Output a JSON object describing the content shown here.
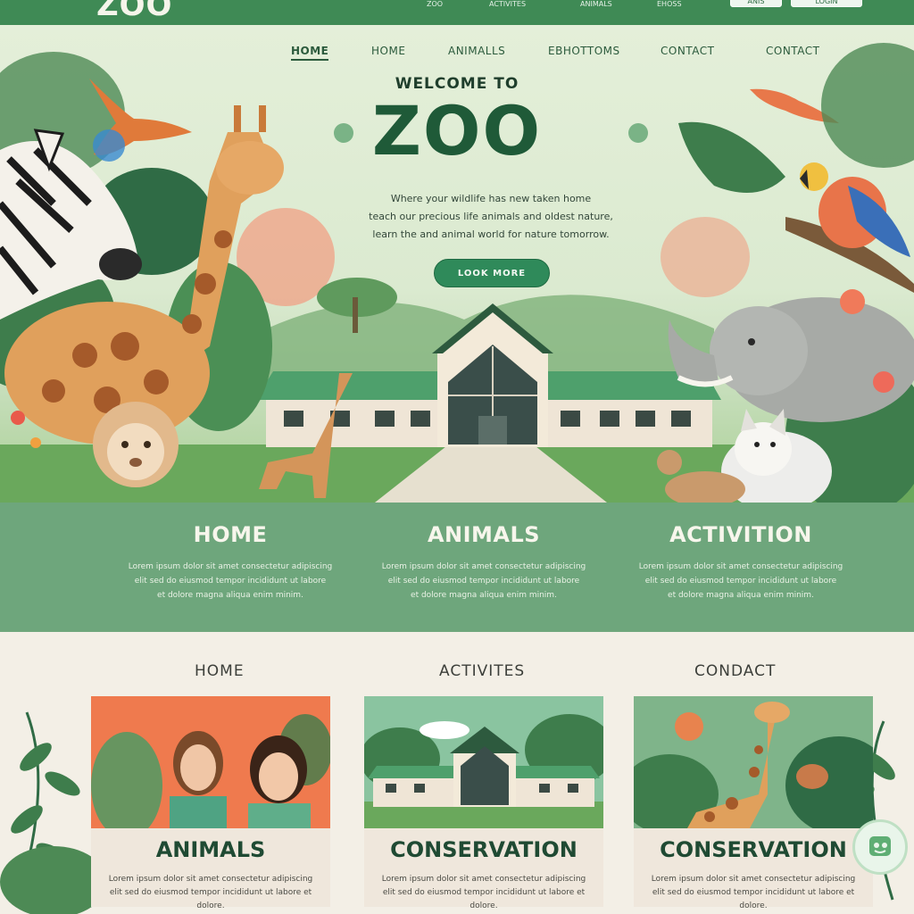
{
  "brand": {
    "logo_text": "ZOO"
  },
  "topbar": {
    "links": [
      "ZOO",
      "ACTIVITES",
      "ANIMALS",
      "EHOSS"
    ],
    "buttons": [
      "ANIS",
      "LOGIN"
    ]
  },
  "hero": {
    "nav": [
      "HOME",
      "HOME",
      "ANIMALLS",
      "EBHOTTOMS",
      "CONTACT",
      "CONTACT"
    ],
    "welcome": "WELCOME TO",
    "title": "ZOO",
    "tagline": [
      "Where your wildlife has new taken home",
      "teach our precious life animals and oldest nature,",
      "learn the and animal world for nature tomorrow."
    ],
    "cta_label": "LOOK MORE"
  },
  "strip": [
    {
      "title": "HOME",
      "lines": [
        "Lorem ipsum dolor sit amet consectetur adipiscing",
        "elit sed do eiusmod tempor incididunt ut labore",
        "et dolore magna aliqua enim minim."
      ]
    },
    {
      "title": "ANIMALS",
      "lines": [
        "Lorem ipsum dolor sit amet consectetur adipiscing",
        "elit sed do eiusmod tempor incididunt ut labore",
        "et dolore magna aliqua enim minim."
      ]
    },
    {
      "title": "ACTIVITION",
      "lines": [
        "Lorem ipsum dolor sit amet consectetur adipiscing",
        "elit sed do eiusmod tempor incididunt ut labore",
        "et dolore magna aliqua enim minim."
      ]
    }
  ],
  "cards_section": {
    "labels": [
      "HOME",
      "ACTIVITES",
      "CONDACT"
    ],
    "cards": [
      {
        "title": "ANIMALS",
        "text": "Lorem ipsum dolor sit amet consectetur adipiscing elit sed do eiusmod tempor incididunt ut labore et dolore."
      },
      {
        "title": "CONSERVATION",
        "text": "Lorem ipsum dolor sit amet consectetur adipiscing elit sed do eiusmod tempor incididunt ut labore et dolore."
      },
      {
        "title": "CONSERVATION",
        "text": "Lorem ipsum dolor sit amet consectetur adipiscing elit sed do eiusmod tempor incididunt ut labore et dolore."
      }
    ]
  },
  "colors": {
    "brand_green": "#3f8a55",
    "strip_green": "#6ea67c",
    "title_green": "#1f5a38",
    "cta_green": "#2f8a5a"
  },
  "icons": [
    "bird-icon",
    "parrot-icon",
    "help-chat-icon"
  ]
}
